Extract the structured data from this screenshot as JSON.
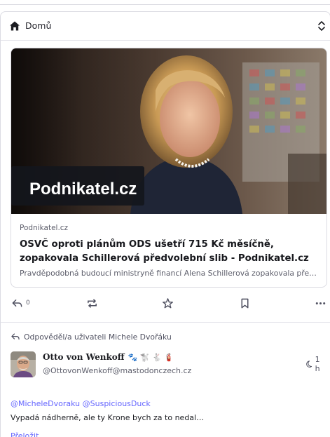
{
  "header": {
    "title": "Domů",
    "home_icon": "home-icon",
    "selector_icon": "chevron-updown-icon"
  },
  "card": {
    "image_brand": "Podnikatel.cz",
    "source": "Podnikatel.cz",
    "headline": "OSVČ oproti plánům ODS ušetří 715 Kč měsíčně, zopakovala Schillerová předvolební slib - Podnikatel.cz",
    "description": "Pravděpodobná budoucí ministryně financí Alena Schillerová zopakovala předvolební slib…"
  },
  "actions": {
    "reply_count": "0",
    "icons": [
      "reply-icon",
      "boost-icon",
      "star-icon",
      "bookmark-icon",
      "more-icon"
    ]
  },
  "reply_context": {
    "text": "Odpověděl/a uživateli Michele Dvořáku"
  },
  "post": {
    "display_name": "Otto von Wenkoff",
    "emojis": "🐾 🐩 🐇 🧯",
    "handle": "@OttovonWenkoff@mastodonczech.cz",
    "time": "1 h",
    "mentions": "@MicheleDvoraku @SuspiciousDuck",
    "text": "Vypadá nádherně, ale ty Krone bych za to nedal…",
    "translate": "Přeložit"
  },
  "colors": {
    "accent": "#6364ff",
    "border": "#dcdce3",
    "muted_text": "#5d5e6b"
  }
}
